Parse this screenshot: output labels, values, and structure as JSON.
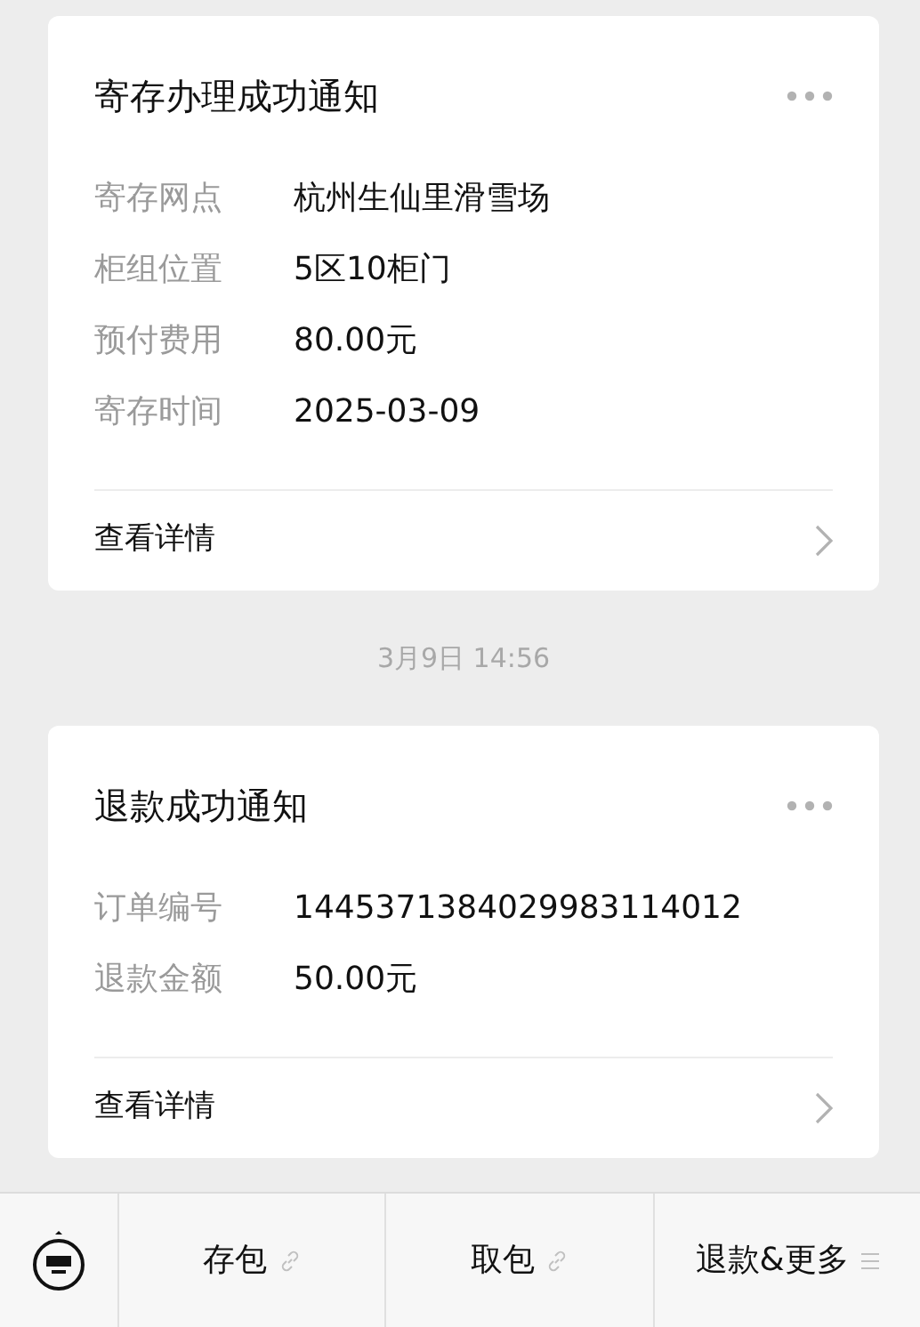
{
  "messages": [
    {
      "kind": "card",
      "title": "寄存办理成功通知",
      "fields": [
        {
          "label": "寄存网点",
          "value": "杭州生仙里滑雪场"
        },
        {
          "label": "柜组位置",
          "value": "5区10柜门"
        },
        {
          "label": "预付费用",
          "value": "80.00元"
        },
        {
          "label": "寄存时间",
          "value": "2025-03-09"
        }
      ],
      "link": "查看详情"
    },
    {
      "kind": "time",
      "text": "3月9日 14:56"
    },
    {
      "kind": "card",
      "title": "退款成功通知",
      "fields": [
        {
          "label": "订单编号",
          "value": "1445371384029983114012"
        },
        {
          "label": "退款金额",
          "value": "50.00元"
        }
      ],
      "link": "查看详情"
    }
  ],
  "menu": [
    {
      "label": "存包",
      "kind": "link"
    },
    {
      "label": "取包",
      "kind": "link"
    },
    {
      "label": "退款&更多",
      "kind": "submenu"
    }
  ]
}
